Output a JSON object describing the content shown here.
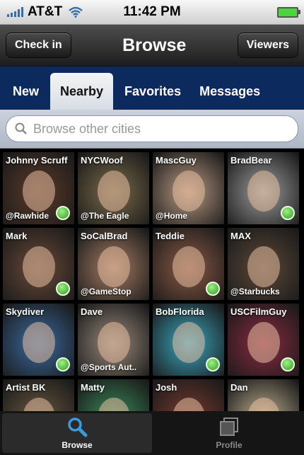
{
  "status_bar": {
    "carrier": "AT&T",
    "time": "11:42 PM"
  },
  "header": {
    "left_button": "Check in",
    "title": "Browse",
    "right_button": "Viewers"
  },
  "tabs": [
    {
      "label": "New"
    },
    {
      "label": "Nearby"
    },
    {
      "label": "Favorites"
    },
    {
      "label": "Messages"
    }
  ],
  "search": {
    "placeholder": "Browse other cities"
  },
  "profiles": [
    {
      "name": "Johnny Scruff",
      "location": "@Rawhide",
      "online": true,
      "color": "#5a3a2a"
    },
    {
      "name": "NYCWoof",
      "location": "@The Eagle",
      "online": false,
      "color": "#7a6a4a"
    },
    {
      "name": "MascGuy",
      "location": "@Home",
      "online": false,
      "color": "#b99a82"
    },
    {
      "name": "BradBear",
      "location": "",
      "online": true,
      "color": "#9c9c9c"
    },
    {
      "name": "Mark",
      "location": "",
      "online": true,
      "color": "#6a4a38"
    },
    {
      "name": "SoCalBrad",
      "location": "@GameStop",
      "online": false,
      "color": "#a57c63"
    },
    {
      "name": "Teddie",
      "location": "",
      "online": true,
      "color": "#8c5a45"
    },
    {
      "name": "MAX",
      "location": "@Starbucks",
      "online": false,
      "color": "#5d4838"
    },
    {
      "name": "Skydiver",
      "location": "",
      "online": true,
      "color": "#3a6aa0"
    },
    {
      "name": "Dave",
      "location": "@Sports Aut...",
      "online": false,
      "color": "#9a8a7c"
    },
    {
      "name": "BobFlorida",
      "location": "",
      "online": true,
      "color": "#3aa7c0"
    },
    {
      "name": "USCFilmGuy",
      "location": "",
      "online": true,
      "color": "#8a2a40"
    },
    {
      "name": "Artist BK",
      "location": "",
      "online": false,
      "color": "#6a5840"
    },
    {
      "name": "Matty",
      "location": "",
      "online": false,
      "color": "#3a8c5a"
    },
    {
      "name": "Josh",
      "location": "",
      "online": false,
      "color": "#7a3a30"
    },
    {
      "name": "Dan",
      "location": "",
      "online": false,
      "color": "#c0b090"
    }
  ],
  "tabbar": [
    {
      "label": "Browse",
      "icon": "search-icon"
    },
    {
      "label": "Profile",
      "icon": "profile-icon"
    }
  ],
  "colors": {
    "nav_blue": "#0d2a5e",
    "online_green": "#2f9e1f",
    "battery_green": "#4ad73a"
  }
}
